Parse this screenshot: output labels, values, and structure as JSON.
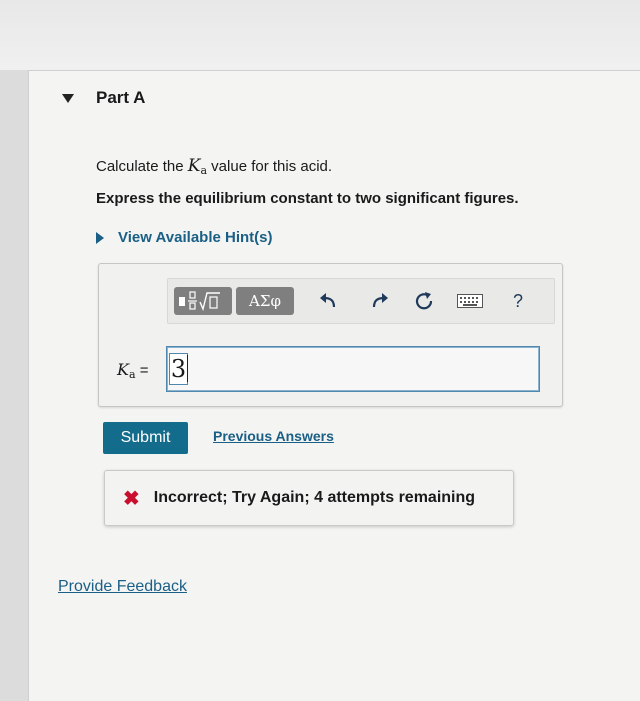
{
  "part": {
    "title": "Part A"
  },
  "question": {
    "prefix": "Calculate the",
    "k_symbol": "K",
    "k_subscript": "a",
    "suffix": "value for this acid.",
    "instruction": "Express the equilibrium constant to two significant figures."
  },
  "hint": {
    "label": "View Available Hint(s)"
  },
  "toolbar": {
    "template_icon": "fraction-sqrt-template-icon",
    "greek_label": "ΑΣφ",
    "undo_icon": "undo-arrow-icon",
    "redo_icon": "redo-arrow-icon",
    "reset_icon": "reset-circle-icon",
    "keyboard_icon": "keyboard-icon",
    "help_label": "?"
  },
  "answer": {
    "label_symbol": "K",
    "label_subscript": "a",
    "equals": "=",
    "value": "3"
  },
  "actions": {
    "submit_label": "Submit",
    "previous_answers_label": "Previous Answers"
  },
  "feedback": {
    "icon": "x-mark-icon",
    "message": "Incorrect; Try Again; 4 attempts remaining",
    "color": "#c8102e"
  },
  "footer": {
    "provide_feedback_label": "Provide Feedback"
  },
  "colors": {
    "accent": "#146c8d",
    "link": "#1a5f85"
  }
}
